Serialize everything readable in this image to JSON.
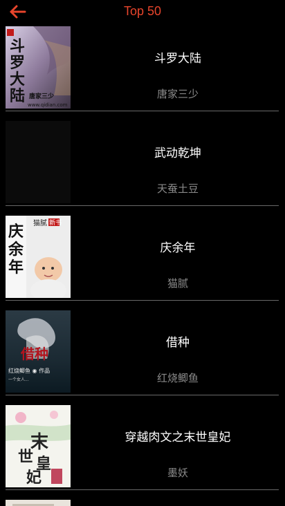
{
  "header": {
    "title": "Top 50",
    "back_icon": "arrow-left-icon",
    "accent_color": "#e8452c"
  },
  "books": [
    {
      "title": "斗罗大陆",
      "author": "唐家三少",
      "cover_text": "斗罗大陆",
      "cover_sub": "唐家三少",
      "cover_site": "www.qidian.com"
    },
    {
      "title": "武动乾坤",
      "author": "天蚕土豆"
    },
    {
      "title": "庆余年",
      "author": "猫腻",
      "cover_text": "庆余年",
      "cover_badge": "新书"
    },
    {
      "title": "借种",
      "author": "红烧鲫鱼",
      "cover_text": "借种"
    },
    {
      "title": "穿越肉文之末世皇妃",
      "author": "墨妖",
      "cover_text": "末世皇妃"
    }
  ]
}
